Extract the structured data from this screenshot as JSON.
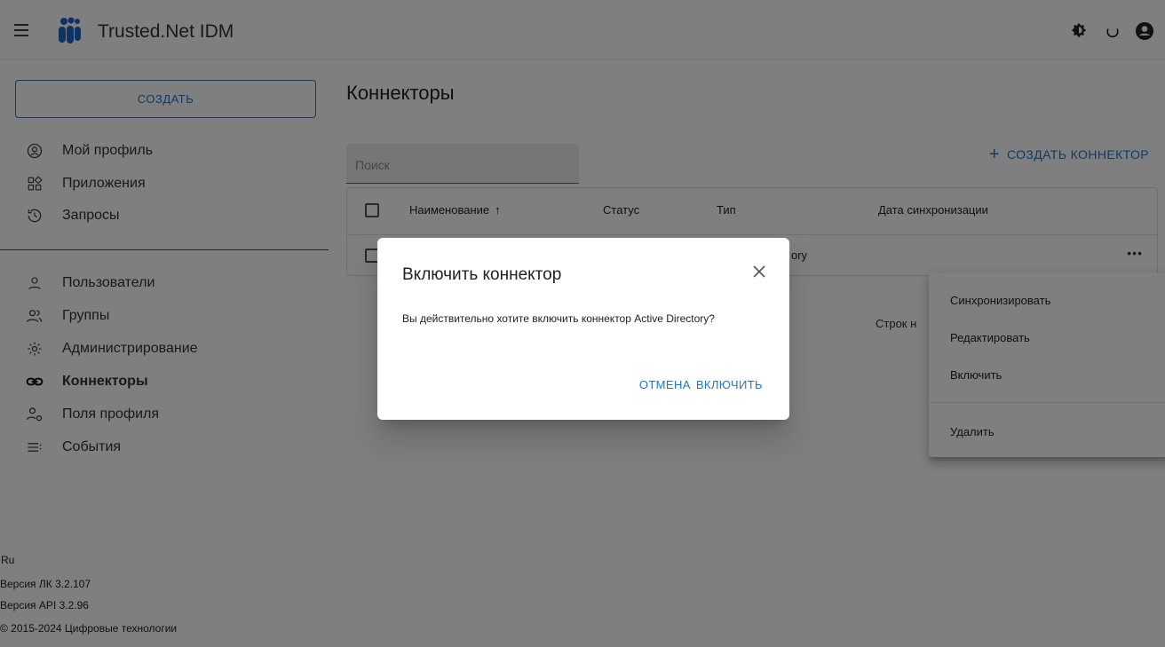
{
  "app": {
    "title": "Trusted.Net IDM"
  },
  "sidebar": {
    "create_label": "СОЗДАТЬ",
    "items_top": [
      {
        "label": "Мой профиль",
        "icon": "account-circle-icon"
      },
      {
        "label": "Приложения",
        "icon": "apps-icon"
      },
      {
        "label": "Запросы",
        "icon": "history-icon"
      }
    ],
    "items_bottom": [
      {
        "label": "Пользователи",
        "icon": "user-icon"
      },
      {
        "label": "Группы",
        "icon": "group-icon"
      },
      {
        "label": "Администрирование",
        "icon": "settings-icon"
      },
      {
        "label": "Коннекторы",
        "icon": "link-icon"
      },
      {
        "label": "Поля профиля",
        "icon": "profile-fields-icon"
      },
      {
        "label": "События",
        "icon": "events-icon"
      }
    ],
    "footer": {
      "lang": "Ru",
      "version_lk": "Версия ЛК 3.2.107",
      "version_api": "Версия API 3.2.96",
      "copyright": "© 2015-2024 Цифровые технологии"
    }
  },
  "main": {
    "title": "Коннекторы",
    "search_placeholder": "Поиск",
    "create_connector_label": "СОЗДАТЬ КОННЕКТОР",
    "table": {
      "columns": [
        "Наименование",
        "Статус",
        "Тип",
        "Дата синхронизации"
      ],
      "sort_indicator": "↑",
      "row_partial_text": "ory",
      "row_more": "•••"
    },
    "rows_per_page_partial": "Строк н"
  },
  "context_menu": {
    "items": [
      "Синхронизировать",
      "Редактировать",
      "Включить",
      "Удалить"
    ]
  },
  "dialog": {
    "title": "Включить коннектор",
    "text": "Вы действительно хотите включить коннектор Active Directory?",
    "cancel_label": "ОТМЕНА",
    "confirm_label": "ВКЛЮЧИТЬ"
  },
  "colors": {
    "accent": "#1976d2",
    "overlay": "rgba(0,0,0,0.5)"
  }
}
